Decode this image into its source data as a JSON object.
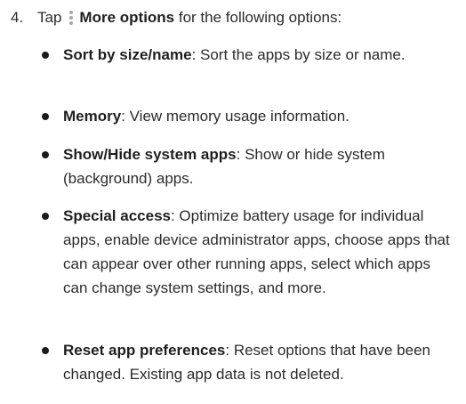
{
  "step": {
    "number": "4.",
    "prefix": "Tap",
    "icon": "more-options-vertical-dots-icon",
    "bold": "More options",
    "suffix": "for the following options:"
  },
  "options": [
    {
      "title": "Sort by size/name",
      "description": ": Sort the apps by size or name."
    },
    {
      "title": "Memory",
      "description": ": View memory usage information."
    },
    {
      "title": "Show/Hide system apps",
      "description": ": Show or hide system (background) apps."
    },
    {
      "title": "Special access",
      "description": ": Optimize battery usage for individual apps, enable device administrator apps, choose apps that can appear over other running apps, select which apps can change system settings, and more."
    },
    {
      "title": "Reset app preferences",
      "description": ": Reset options that have been changed. Existing app data is not deleted."
    }
  ]
}
